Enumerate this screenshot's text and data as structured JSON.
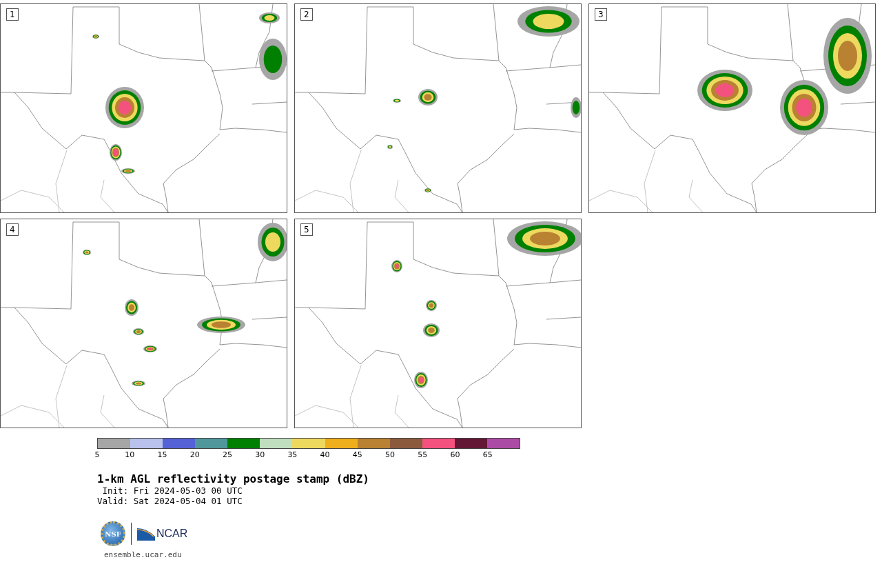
{
  "panels": [
    {
      "label": "1"
    },
    {
      "label": "2"
    },
    {
      "label": "3"
    },
    {
      "label": "4"
    },
    {
      "label": "5"
    }
  ],
  "colorbar": {
    "segments": [
      {
        "color": "#a6a6a6"
      },
      {
        "color": "#b8c2ec"
      },
      {
        "color": "#5562d6"
      },
      {
        "color": "#50979c"
      },
      {
        "color": "#008000"
      },
      {
        "color": "#bfdfbf"
      },
      {
        "color": "#eed95f"
      },
      {
        "color": "#efae1c"
      },
      {
        "color": "#b88232"
      },
      {
        "color": "#8b5a3c"
      },
      {
        "color": "#f4527e"
      },
      {
        "color": "#631735"
      },
      {
        "color": "#ac4ba5"
      }
    ],
    "ticks": [
      "5",
      "10",
      "15",
      "20",
      "25",
      "30",
      "35",
      "40",
      "45",
      "50",
      "55",
      "60",
      "65"
    ]
  },
  "title": "1-km AGL reflectivity postage stamp (dBZ)",
  "init": " Init: Fri 2024-05-03 00 UTC",
  "valid": "Valid: Sat 2024-05-04 01 UTC",
  "logos": {
    "nsf": "NSF",
    "ncar": "NCAR"
  },
  "url": "ensemble.ucar.edu"
}
